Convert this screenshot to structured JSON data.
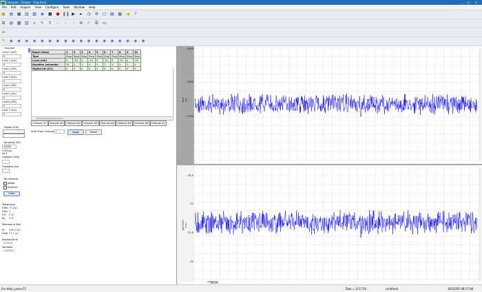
{
  "window": {
    "title": "Clampex - [Scope - Gap-free]"
  },
  "menu": [
    "File",
    "Edit",
    "Acquire",
    "View",
    "Configure",
    "Tools",
    "Window",
    "Help"
  ],
  "left_panel": {
    "section_title": "Scp-ben",
    "cmd_channels": [
      {
        "label": "Cmd 0 (mV)",
        "value": "0"
      },
      {
        "label": "Cmd 1 (mV)",
        "value": "0"
      },
      {
        "label": "Cmd 2 (mV)",
        "value": "0"
      },
      {
        "label": "Cmd 3 (mV)",
        "value": "0"
      },
      {
        "label": "Cmd 4 (mV)",
        "value": "0"
      },
      {
        "label": "Cmd 5 (mV)",
        "value": "0"
      },
      {
        "label": "Cmd 6 (mV)",
        "value": "0"
      },
      {
        "label": "Cmd 7 (mV)",
        "value": "0"
      }
    ],
    "digital_outs_label": "Digital OUTs",
    "sampling_label": "Sampling (Hz)",
    "sampling_value": "10000",
    "sampling_sub": "(100 µs)",
    "sampling_sub2": "(N 3",
    "lowpass_label": "Lowpass (kHz)",
    "highpass_label": "Highpass (Hz)",
    "runsilencer_label": "RunSilencer",
    "adapt_label": "Adapt",
    "subtract_label": "Subtract",
    "clear_label": "Clear",
    "telegraphs_label": "Telegraphs",
    "filter_label": "Filter",
    "filter_value": "10 kHz",
    "gain_label": "Gain",
    "gain_value": "1",
    "cm_label": "Cm",
    "cm_value": "0 pF",
    "rs_label": "Rs",
    "rs_value": "0 M",
    "membrane_test_label": "Membrane Test",
    "rt_label": "Rt",
    "rt_value": "456.5 MΩ",
    "hold_label": "Hold",
    "hold_value": "57.1 pA",
    "elapsed_label": "Elapsed time",
    "elapsed_value": "0:09:54",
    "samples_label": "Samples",
    "samples_value": "1119222"
  },
  "epoch_table": {
    "columns": [
      "Epoch times",
      "1",
      "2",
      "3",
      "4",
      "5",
      "6",
      "7",
      "8",
      "9",
      "10"
    ],
    "rows": [
      {
        "label": "Type",
        "cells": [
          "Step",
          "Step",
          "Step",
          "Step",
          "Step",
          "Step",
          "Step",
          "Step",
          "Step",
          "Step"
        ]
      },
      {
        "label": "Level (mV)",
        "cells": [
          "0",
          "-75",
          "0",
          "-75",
          "0",
          "-75",
          "0",
          "-75",
          "0",
          "-75"
        ]
      },
      {
        "label": "Duration (seconds)",
        "cells": [
          "70",
          "1",
          "1",
          "1",
          "1",
          "1",
          "1",
          "1",
          "1",
          "1"
        ]
      },
      {
        "label": "Digital bit (0/1)",
        "cells": [
          "0",
          "0",
          "0",
          "0",
          "0",
          "0",
          "0",
          "0",
          "0",
          "0"
        ]
      }
    ],
    "channel_tabs": [
      "Channel #0",
      "Channel #1",
      "Channel #2",
      "Channel #3",
      "Channel #4",
      "Channel #5",
      "Channel #6",
      "Channel #7"
    ],
    "start_from_change_label": "Start From Change",
    "start_from_change_value": "1",
    "apply_label": "Apply",
    "reset_label": "Reset"
  },
  "scope": {
    "top_axis_label": "IN 0",
    "top_axis_unit": "(pA)",
    "top_ticks": [
      "-7000",
      "-7050",
      "-7100"
    ],
    "bottom_axis_label": "Lal Cell 1",
    "bottom_axis_unit": "(mV)",
    "bottom_ticks": [
      "-70.5",
      "-71",
      "-71.5",
      "-72"
    ],
    "time_scale_label": "100 ms",
    "trace_color": "#0000ff"
  },
  "status": {
    "help": "For Help, press F1",
    "disk": "Disk = 0:17:54",
    "file": "(untitled)",
    "datetime": "10/22/05 08:17:06"
  }
}
